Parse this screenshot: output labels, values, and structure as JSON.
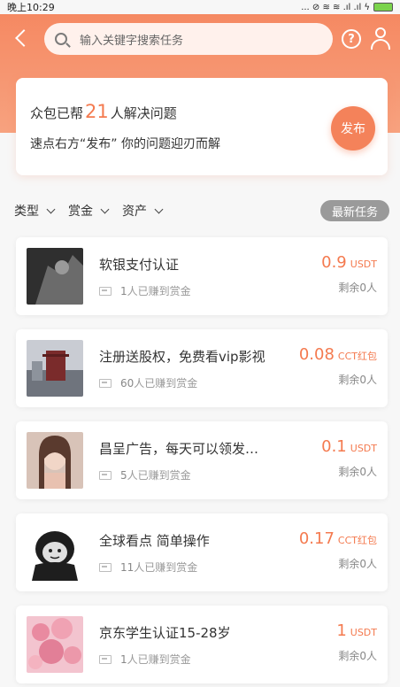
{
  "status_bar": {
    "time": "晚上10:29",
    "icons": "... ⊘ ≋ ≋ .ıl .ıl ϟ"
  },
  "nav": {
    "back_icon": "back-arrow-icon",
    "search_placeholder": "输入关键字搜索任务",
    "help_symbol": "?",
    "profile_icon": "user-icon"
  },
  "banner": {
    "line1_prefix": "众包已帮",
    "helped_count": "21",
    "line1_suffix": "人解决问题",
    "line2": "速点右方“发布”  你的问题迎刃而解",
    "publish_label": "发布"
  },
  "filters": [
    {
      "label": "类型"
    },
    {
      "label": "赏金"
    },
    {
      "label": "资产"
    }
  ],
  "latest_label": "最新任务",
  "tasks": [
    {
      "title": "软银支付认证",
      "earned_count": "1",
      "earned_suffix": "人已赚到赏金",
      "amount": "0.9",
      "unit": "USDT",
      "remaining": "剩余0人",
      "thumb_color": "#3a3a3a"
    },
    {
      "title": "注册送股权，免费看vip影视",
      "earned_count": "60",
      "earned_suffix": "人已赚到赏金",
      "amount": "0.08",
      "unit": "CCT红包",
      "remaining": "剩余0人",
      "thumb_color": "#8a8f99"
    },
    {
      "title": "昌呈广告，每天可以领发红包",
      "earned_count": "5",
      "earned_suffix": "人已赚到赏金",
      "amount": "0.1",
      "unit": "USDT",
      "remaining": "剩余0人",
      "thumb_color": "#d9b7a8"
    },
    {
      "title": "全球看点 简单操作",
      "earned_count": "11",
      "earned_suffix": "人已赚到赏金",
      "amount": "0.17",
      "unit": "CCT红包",
      "remaining": "剩余0人",
      "thumb_color": "#e8e8e8"
    },
    {
      "title": "京东学生认证15-28岁",
      "earned_count": "1",
      "earned_suffix": "人已赚到赏金",
      "amount": "1",
      "unit": "USDT",
      "remaining": "剩余0人",
      "thumb_color": "#e9a1b0"
    }
  ],
  "colors": {
    "accent": "#f47a4f",
    "header": "#f5865f",
    "latest_button": "#9a9a9a"
  }
}
